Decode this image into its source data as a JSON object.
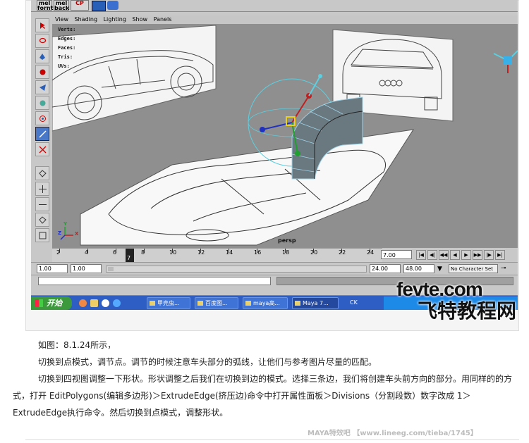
{
  "shelf": {
    "buttons": [
      {
        "top": "mel",
        "bottom": "fornt"
      },
      {
        "top": "mel",
        "bottom": "back"
      },
      {
        "top": "",
        "bottom": "CP"
      }
    ]
  },
  "viewport": {
    "menu": [
      "View",
      "Shading",
      "Lighting",
      "Show",
      "Panels"
    ],
    "hud": [
      "Verts:",
      "Edges:",
      "Faces:",
      "Tris:",
      "UVs:"
    ],
    "camera_label": "persp",
    "axis_labels": [
      "X",
      "Y",
      "Z"
    ]
  },
  "timeline": {
    "ticks": [
      "2",
      "4",
      "6",
      "8",
      "10",
      "12",
      "14",
      "16",
      "18",
      "20",
      "22",
      "24"
    ],
    "current_label": "7",
    "current_frame": "7.00"
  },
  "range": {
    "start": "1.00",
    "inner_start": "1.00",
    "inner_end": "24.00",
    "end": "48.00",
    "character_set": "No Character Set"
  },
  "taskbar": {
    "start_label": "开始",
    "tasks": [
      "甲壳虫...",
      "百度图...",
      "maya高...",
      "Maya 7..."
    ],
    "tray_text": "CK"
  },
  "logo": {
    "en": "fevte.com",
    "cn": "飞特教程网"
  },
  "article": {
    "p1": "如图：8.1.24所示，",
    "p2": "切换到点模式，调节点。调节的时候注意车头部分的弧线，让他们与参考图片尽量的匹配。",
    "p3": "切换到四视图调整一下形状。形状调整之后我们在切换到边的模式。选择三条边，我们将创建车头前方向的部分。用同样的的方",
    "p4": "式，打开 EditPolygons(编辑多边形)＞ExtrudeEdge(挤压边)命令中打开属性面板＞Divisions（分割段数）数字改成 1＞",
    "p5": "ExtrudeEdge执行命令。然后切换到点模式，调整形状。"
  },
  "watermark": "MAYA特效吧 【www.lineeg.com/tieba/1745】",
  "colors": {
    "viewport_bg": "#8f8f8f",
    "selected_tool": "#4a78c8",
    "taskbar": "#2e5ec4",
    "start_button": "#3c9a3c"
  }
}
